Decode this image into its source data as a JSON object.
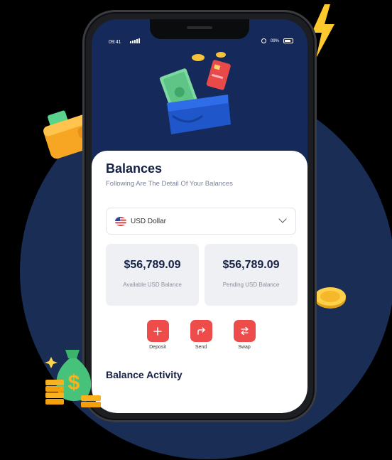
{
  "status_bar": {
    "time": "09:41",
    "battery": "09%"
  },
  "balances": {
    "title": "Balances",
    "subtitle": "Following Are The Detail Of Your Balances",
    "currency_select": {
      "value": "USD Dollar",
      "flag": "us-flag-icon"
    },
    "available": {
      "amount": "$56,789.09",
      "label": "Available USD Balance"
    },
    "pending": {
      "amount": "$56,789.09",
      "label": "Pending USD Balance"
    }
  },
  "actions": [
    {
      "label": "Deposit",
      "icon": "plus-icon"
    },
    {
      "label": "Send",
      "icon": "share-arrow-icon"
    },
    {
      "label": "Swap",
      "icon": "swap-arrows-icon"
    }
  ],
  "activity": {
    "title": "Balance Activity"
  },
  "colors": {
    "accent": "#ee4b4b",
    "navy": "#142046",
    "background_circle": "#1a2d55"
  }
}
